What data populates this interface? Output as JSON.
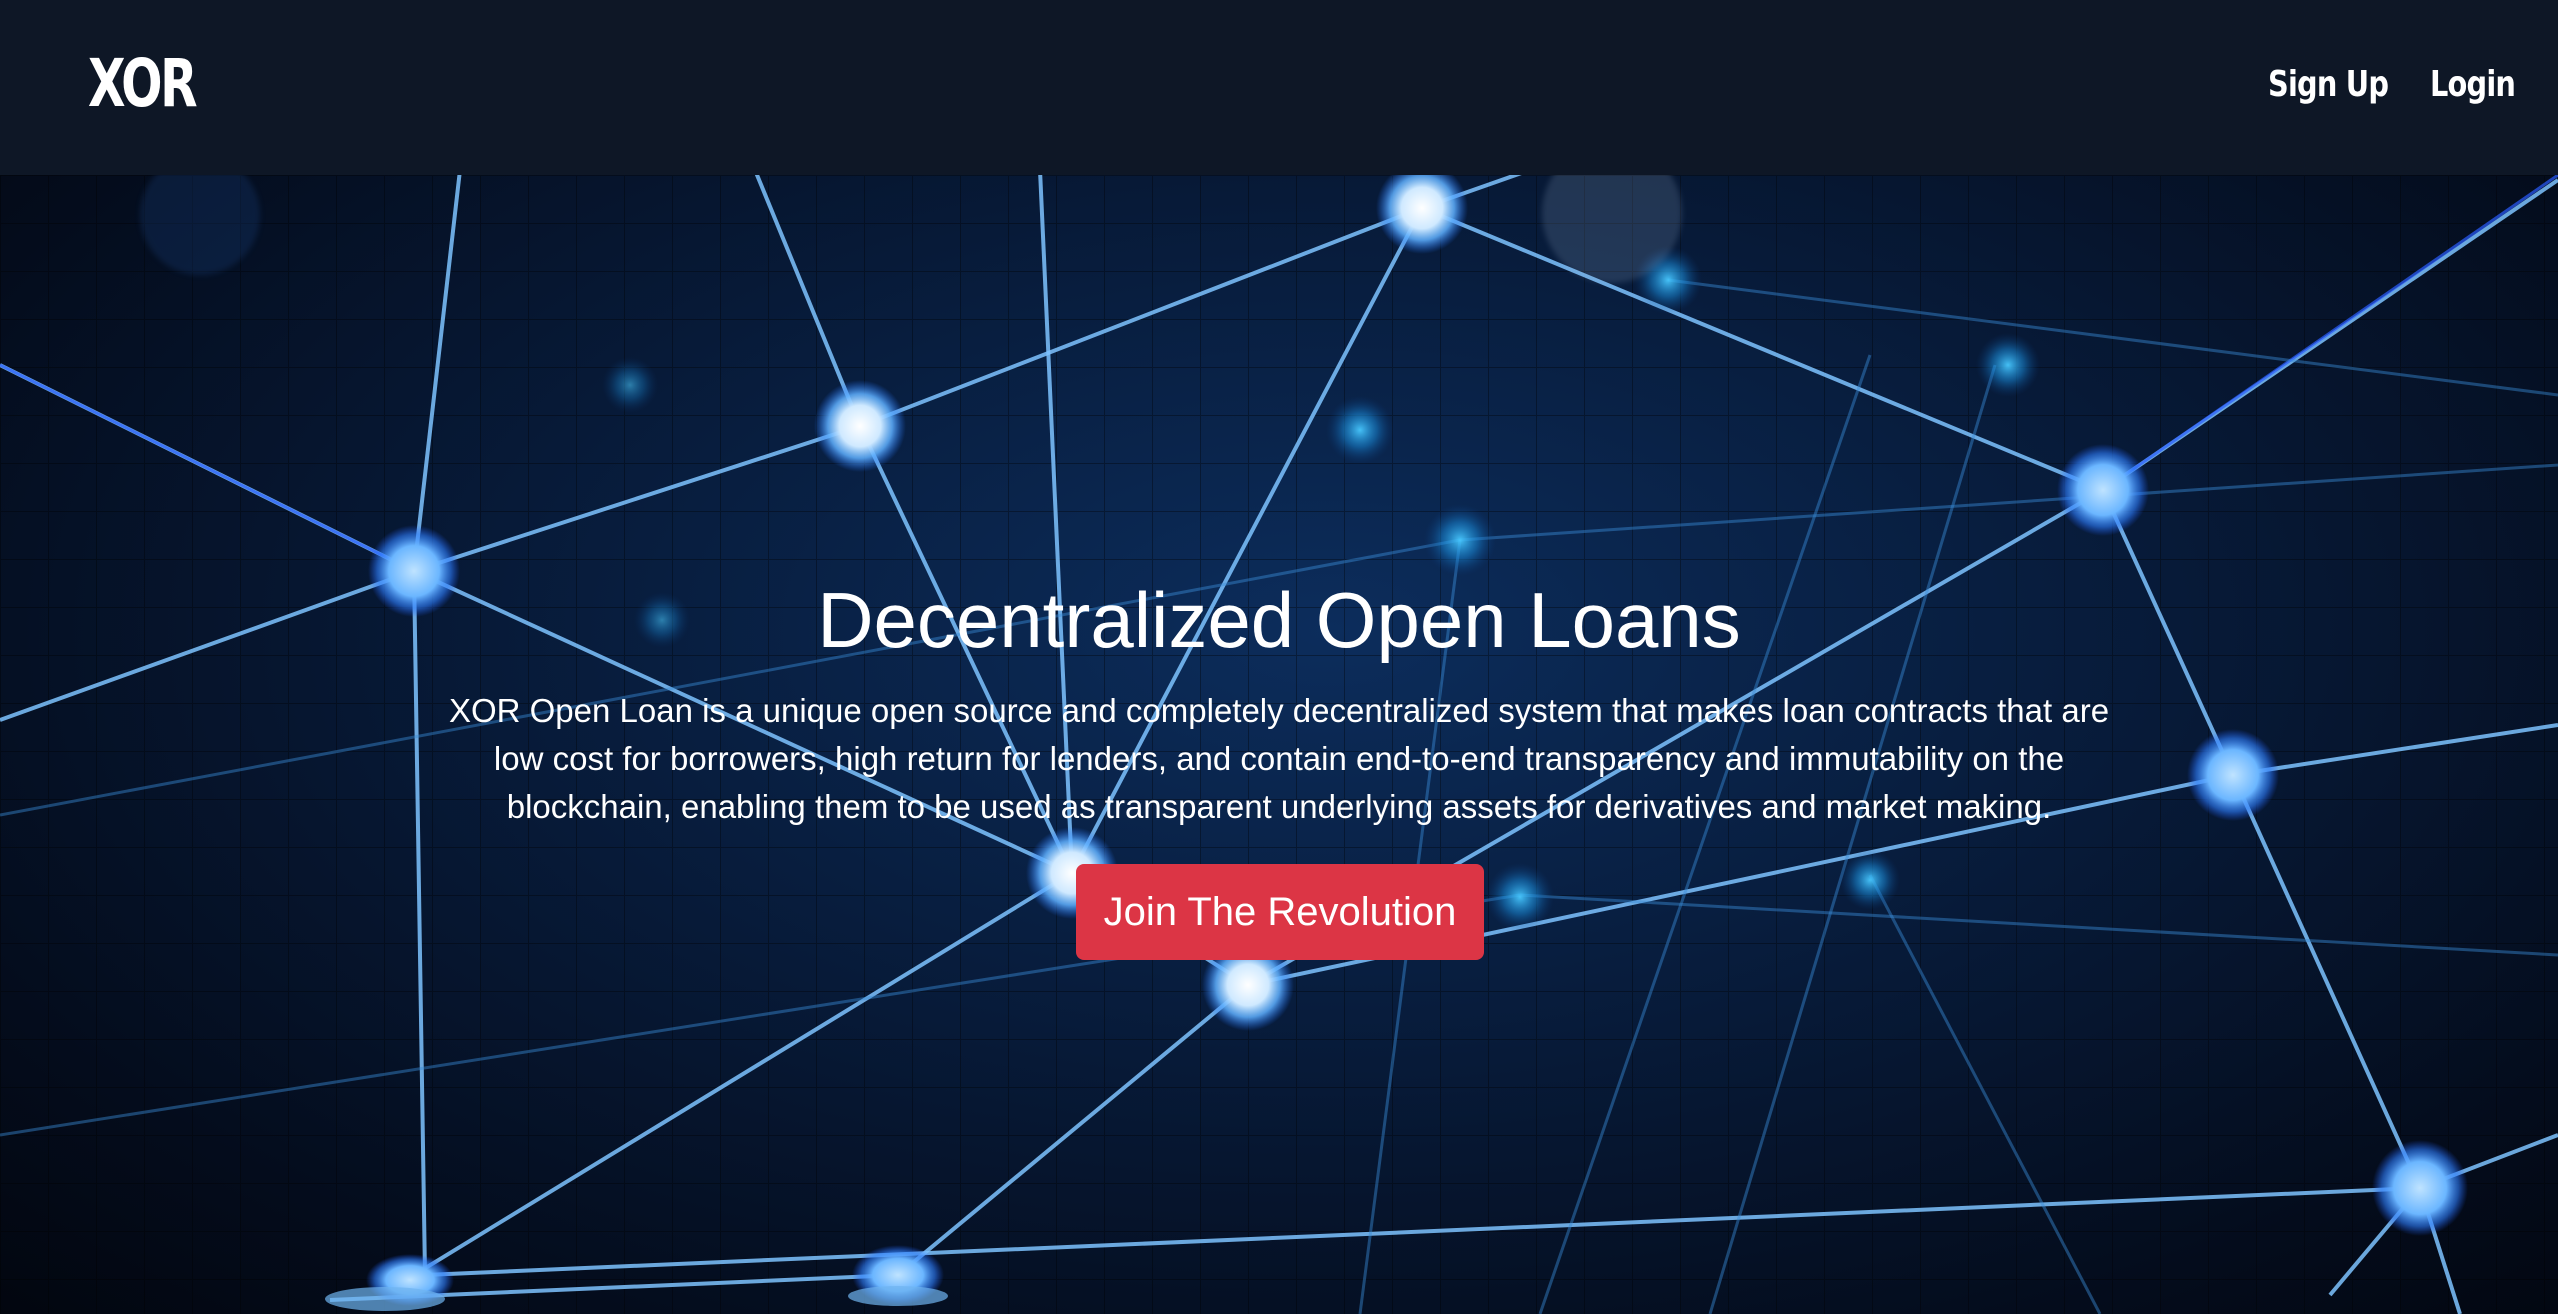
{
  "navbar": {
    "brand": "XOR",
    "links": [
      {
        "label": "Sign Up"
      },
      {
        "label": "Login"
      }
    ]
  },
  "hero": {
    "title": "Decentralized Open Loans",
    "description": "XOR Open Loan is a unique open source and completely decentralized system that makes loan contracts that are low cost for borrowers, high return for lenders, and contain end-to-end transparency and immutability on the blockchain, enabling them to be used as transparent underlying assets for derivatives and market making.",
    "cta_label": "Join The Revolution"
  },
  "colors": {
    "navbar_bg": "#0e1726",
    "cta_bg": "#dc3545",
    "network_line": "#6ab4ff",
    "network_node": "#9fd4ff"
  },
  "background_image": "blockchain-network-graphic"
}
